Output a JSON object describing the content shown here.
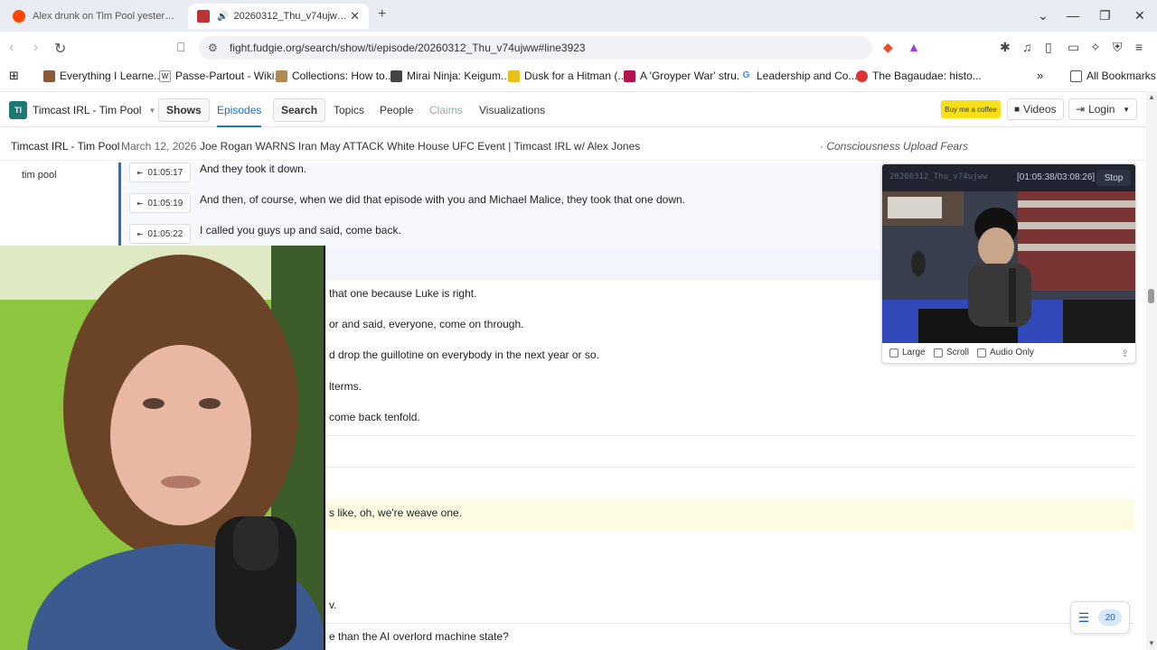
{
  "browser": {
    "tabs": [
      {
        "title": "Alex drunk on Tim Pool yesterday : r/",
        "active": false
      },
      {
        "title": "20260312_Thu_v74ujww.mp3",
        "active": true
      }
    ],
    "url": "fight.fudgie.org/search/show/ti/episode/20260312_Thu_v74ujww#line3923",
    "bookmarks": [
      "Everything I Learne...",
      "Passe-Partout - Wiki...",
      "Collections: How to...",
      "Mirai Ninja: Keigum...",
      "Dusk for a Hitman (...",
      "A 'Groyper War' stru...",
      "Leadership and Co...",
      "The Bagaudae: histo..."
    ],
    "all_bookmarks": "All Bookmarks",
    "more_bookmarks": "»"
  },
  "site": {
    "show_name": "Timcast IRL - Tim Pool",
    "show_logo": "TI",
    "nav": {
      "shows": "Shows",
      "episodes": "Episodes",
      "search": "Search",
      "topics": "Topics",
      "people": "People",
      "claims": "Claims",
      "visualizations": "Visualizations"
    },
    "coffee": "Buy me a coffee",
    "videos": "Videos",
    "login": "Login"
  },
  "episode": {
    "show": "Timcast IRL - Tim Pool",
    "date": "March 12, 2026",
    "title": "Joe Rogan WARNS Iran May ATTACK White House UFC Event | Timcast IRL w/ Alex Jones",
    "topic": "· Consciousness Upload Fears"
  },
  "transcript": {
    "speaker": "tim pool",
    "lines": [
      {
        "ts": "01:05:17",
        "text": "And they took it down."
      },
      {
        "ts": "01:05:19",
        "text": "And then, of course, when we did that episode with you and Michael Malice, they took that one down."
      },
      {
        "ts": "01:05:22",
        "text": "I called you guys up and said, come back."
      }
    ],
    "partial_lines": [
      "that one because Luke is right.",
      "or and said, everyone, come on through.",
      "d drop the guillotine on everybody in the next year or so.",
      "lterms.",
      "come back tenfold.",
      "s like, oh, we're weave one.",
      "v.",
      "e than the AI overlord machine state?"
    ]
  },
  "player": {
    "file": "20260312_Thu_v74ujww",
    "time": "[01:05:38/03:08:26]",
    "stop": "Stop",
    "options": [
      "Large",
      "Scroll",
      "Audio Only"
    ]
  },
  "toc": {
    "count": "20"
  },
  "colors": {
    "accent": "#1f6fd1",
    "speaker_rule": "#2a6bd1",
    "highlight": "#fdfce3",
    "coffee": "#f7e017"
  }
}
